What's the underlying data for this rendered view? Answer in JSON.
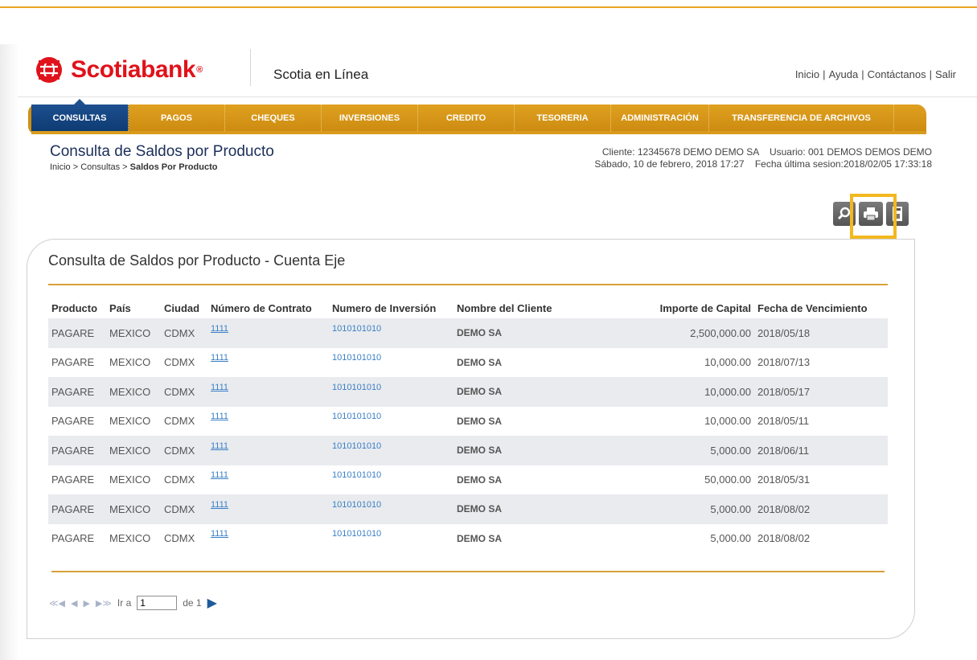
{
  "brand": {
    "name": "Scotiabank",
    "reg": "®",
    "app_name": "Scotia en Línea"
  },
  "top_links": [
    "Inicio",
    "Ayuda",
    "Contáctanos",
    "Salir"
  ],
  "nav": [
    {
      "label": "CONSULTAS",
      "active": true
    },
    {
      "label": "PAGOS"
    },
    {
      "label": "CHEQUES"
    },
    {
      "label": "INVERSIONES"
    },
    {
      "label": "CREDITO"
    },
    {
      "label": "TESORERIA"
    },
    {
      "label": "ADMINISTRACIÓN"
    },
    {
      "label": "TRANSFERENCIA DE ARCHIVOS"
    }
  ],
  "page": {
    "title": "Consulta de Saldos por Producto",
    "breadcrumb_prefix": "Inicio > Consultas > ",
    "breadcrumb_current": "Saldos Por Producto",
    "client_line": "Cliente: 12345678 DEMO DEMO SA    Usuario: 001 DEMOS DEMOS DEMO",
    "date_line": "Sábado, 10 de febrero, 2018 17:27    Fecha última sesion:2018/02/05 17:33:18"
  },
  "toolbar": {
    "search_icon": "search-icon",
    "print_icon": "printer-icon",
    "export_icon": "txt-export-icon"
  },
  "panel": {
    "title": "Consulta de Saldos por Producto - Cuenta Eje"
  },
  "table": {
    "headers": [
      "Producto",
      "País",
      "Ciudad",
      "Número de Contrato",
      "Numero de Inversión",
      "Nombre del Cliente",
      "Importe de Capital",
      "Fecha de Vencimiento"
    ],
    "rows": [
      [
        "PAGARE",
        "MEXICO",
        "CDMX",
        "1111",
        "1010101010",
        "DEMO SA",
        "2,500,000.00",
        "2018/05/18"
      ],
      [
        "PAGARE",
        "MEXICO",
        "CDMX",
        "1111",
        "1010101010",
        "DEMO SA",
        "10,000.00",
        "2018/07/13"
      ],
      [
        "PAGARE",
        "MEXICO",
        "CDMX",
        "1111",
        "1010101010",
        "DEMO SA",
        "10,000.00",
        "2018/05/17"
      ],
      [
        "PAGARE",
        "MEXICO",
        "CDMX",
        "1111",
        "1010101010",
        "DEMO SA",
        "10,000.00",
        "2018/05/11"
      ],
      [
        "PAGARE",
        "MEXICO",
        "CDMX",
        "1111",
        "1010101010",
        "DEMO SA",
        "5,000.00",
        "2018/06/11"
      ],
      [
        "PAGARE",
        "MEXICO",
        "CDMX",
        "1111",
        "1010101010",
        "DEMO SA",
        "50,000.00",
        "2018/05/31"
      ],
      [
        "PAGARE",
        "MEXICO",
        "CDMX",
        "1111",
        "1010101010",
        "DEMO SA",
        "5,000.00",
        "2018/08/02"
      ],
      [
        "PAGARE",
        "MEXICO",
        "CDMX",
        "1111",
        "1010101010",
        "DEMO SA",
        "5,000.00",
        "2018/08/02"
      ]
    ]
  },
  "pager": {
    "go_label": "Ir a",
    "page_value": "1",
    "of_label": "de 1"
  },
  "colors": {
    "accent": "#e8a423",
    "nav_active": "#0e3b73",
    "brand_red": "#e0121b",
    "link": "#3a7fc6",
    "highlight": "#f3b81f"
  }
}
